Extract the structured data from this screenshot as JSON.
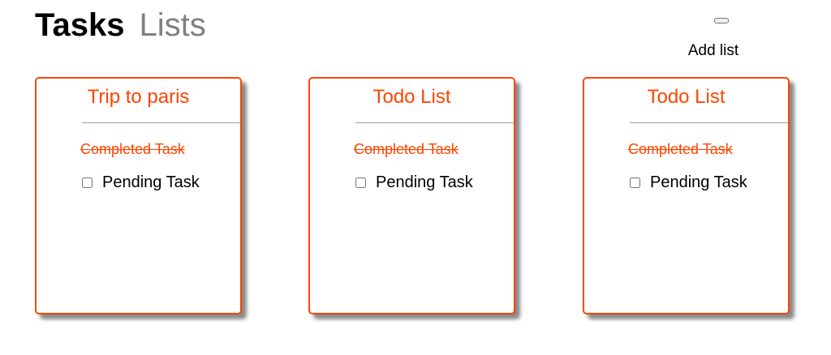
{
  "header": {
    "tabs": [
      {
        "label": "Tasks"
      },
      {
        "label": "Lists"
      }
    ]
  },
  "add_list": {
    "label": "Add list"
  },
  "lists": [
    {
      "title": "Trip to paris",
      "completed_task": "Completed Task",
      "pending_task": "Pending Task"
    },
    {
      "title": "Todo List",
      "completed_task": "Completed Task",
      "pending_task": "Pending Task"
    },
    {
      "title": "Todo List",
      "completed_task": "Completed Task",
      "pending_task": "Pending Task"
    }
  ],
  "colors": {
    "accent": "#ff4500",
    "inactive_tab": "#808080",
    "divider": "#a0a0a0"
  }
}
